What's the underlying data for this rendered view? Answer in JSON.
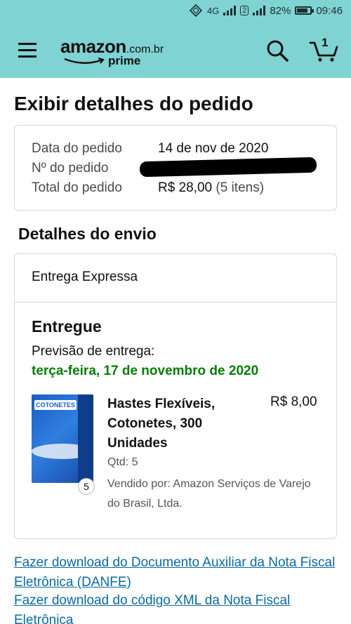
{
  "status_bar": {
    "network": "4G",
    "sim_badge": "2",
    "battery": "82%",
    "battery_level": 0.82,
    "time": "09:46"
  },
  "header": {
    "logo_main": "amazon",
    "logo_domain": ".com.br",
    "logo_prime": "prime",
    "cart_count": "1",
    "icons": [
      "menu-icon",
      "search-icon",
      "cart-icon"
    ],
    "background": "#7fd3d3"
  },
  "page_title": "Exibir detalhes do pedido",
  "order_summary": {
    "date_label": "Data do pedido",
    "date_value": "14 de nov de 2020",
    "number_label": "Nº do pedido",
    "total_label": "Total do pedido",
    "total_value": "R$ 28,00",
    "total_items": "(5 itens)"
  },
  "shipment": {
    "section_title": "Detalhes do envio",
    "method": "Entrega Expressa",
    "status": "Entregue",
    "eta_label": "Previsão de entrega:",
    "eta_date": "terça-feira, 17 de novembro de 2020",
    "eta_color": "#067d06",
    "item": {
      "name": "Hastes Flexíveis, Cotonetes, 300 Unidades",
      "price": "R$ 8,00",
      "quantity": "Qtd: 5",
      "quantity_badge": "5",
      "seller": "Vendido por: Amazon Serviços de Varejo do Brasil, Ltda.",
      "image_brand": "COTONETES"
    }
  },
  "links": {
    "danfe": "Fazer download do Documento Auxiliar da Nota Fiscal Eletrônica (DANFE)",
    "xml": "Fazer download do código XML da Nota Fiscal Eletrônica"
  }
}
